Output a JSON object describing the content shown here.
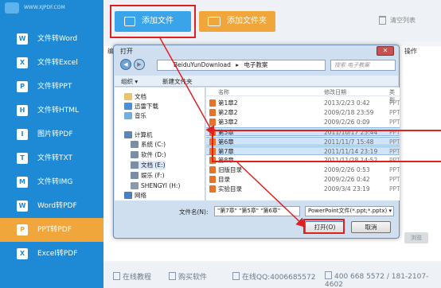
{
  "brand": {
    "url_text": "WWW.XJPDF.COM"
  },
  "sidebar": {
    "items": [
      {
        "label": "文件转Word",
        "icon": "W"
      },
      {
        "label": "文件转Excel",
        "icon": "X"
      },
      {
        "label": "文件转PPT",
        "icon": "P"
      },
      {
        "label": "文件转HTML",
        "icon": "H"
      },
      {
        "label": "图片转PDF",
        "icon": "I"
      },
      {
        "label": "文件转TXT",
        "icon": "T"
      },
      {
        "label": "文件转IMG",
        "icon": "M"
      },
      {
        "label": "Word转PDF",
        "icon": "W"
      },
      {
        "label": "PPT转PDF",
        "icon": "P"
      },
      {
        "label": "Excel转PDF",
        "icon": "X"
      }
    ],
    "active_index": 8
  },
  "toolbar": {
    "add_file": "添加文件",
    "add_folder": "添加文件夹",
    "clear_list": "清空列表"
  },
  "table": {
    "col_left": "编",
    "col_right": "操作"
  },
  "side_button": "浏览",
  "footer": {
    "tutorial": "在线教程",
    "buy": "购买软件",
    "qq": "在线QQ:4006685572",
    "phone": "400 668 5572 / 181-2107-4602"
  },
  "dialog": {
    "title": "打开",
    "close": "✕",
    "path": [
      "BeiduYunDownload",
      "电子教案"
    ],
    "search_placeholder": "搜索 电子教案",
    "organize": "组织 ▾",
    "new_folder": "新建文件夹",
    "list_header": {
      "name": "名称",
      "date": "修改日期",
      "type": "类型"
    },
    "nav_items": [
      {
        "label": "文档",
        "icon": "document-icon"
      },
      {
        "label": "迅雷下载",
        "icon": "download-icon"
      },
      {
        "label": "音乐",
        "icon": "music-icon"
      },
      {
        "label": "计算机",
        "icon": "computer-icon"
      },
      {
        "label": "系统 (C:)",
        "icon": "drive-icon"
      },
      {
        "label": "软件 (D:)",
        "icon": "drive-icon"
      },
      {
        "label": "文档 (E:)",
        "icon": "drive-icon"
      },
      {
        "label": "娱乐 (F:)",
        "icon": "drive-icon"
      },
      {
        "label": "SHENGYI (H:)",
        "icon": "usb-drive-icon"
      },
      {
        "label": "网络",
        "icon": "network-icon"
      }
    ],
    "files": [
      {
        "name": "第1章2",
        "date": "2013/2/23 0:42",
        "type": "PPT",
        "selected": false
      },
      {
        "name": "第2章2",
        "date": "2009/2/18 23:59",
        "type": "PPT",
        "selected": false
      },
      {
        "name": "第3章2",
        "date": "2009/2/26 0:09",
        "type": "PPT",
        "selected": false
      },
      {
        "name": "第5章",
        "date": "2011/10/17 23:44",
        "type": "PPT",
        "selected": true
      },
      {
        "name": "第6章",
        "date": "2011/11/7 15:48",
        "type": "PPT",
        "selected": true
      },
      {
        "name": "第7章",
        "date": "2011/11/14 23:19",
        "type": "PPT",
        "selected": true
      },
      {
        "name": "第8章",
        "date": "2011/11/28 14:52",
        "type": "PPT",
        "selected": false
      },
      {
        "name": "旧版目录",
        "date": "2009/2/26 0:53",
        "type": "PPT",
        "selected": false
      },
      {
        "name": "目录",
        "date": "2009/2/26 0:42",
        "type": "PPT",
        "selected": false
      },
      {
        "name": "实验目录",
        "date": "2009/3/4 23:19",
        "type": "PPT",
        "selected": false
      }
    ],
    "filename_label": "文件名(N):",
    "filename_value": "\"第7章\" \"第5章\" \"第6章\"",
    "filter": "PowerPoint文件(*.ppt;*.pptx) ▾",
    "open": "打开(O)",
    "cancel": "取消"
  },
  "colors": {
    "sidebar": "#1e8ad6",
    "active": "#f0a63a",
    "primary": "#3aa4ea",
    "highlight": "#e02020"
  }
}
